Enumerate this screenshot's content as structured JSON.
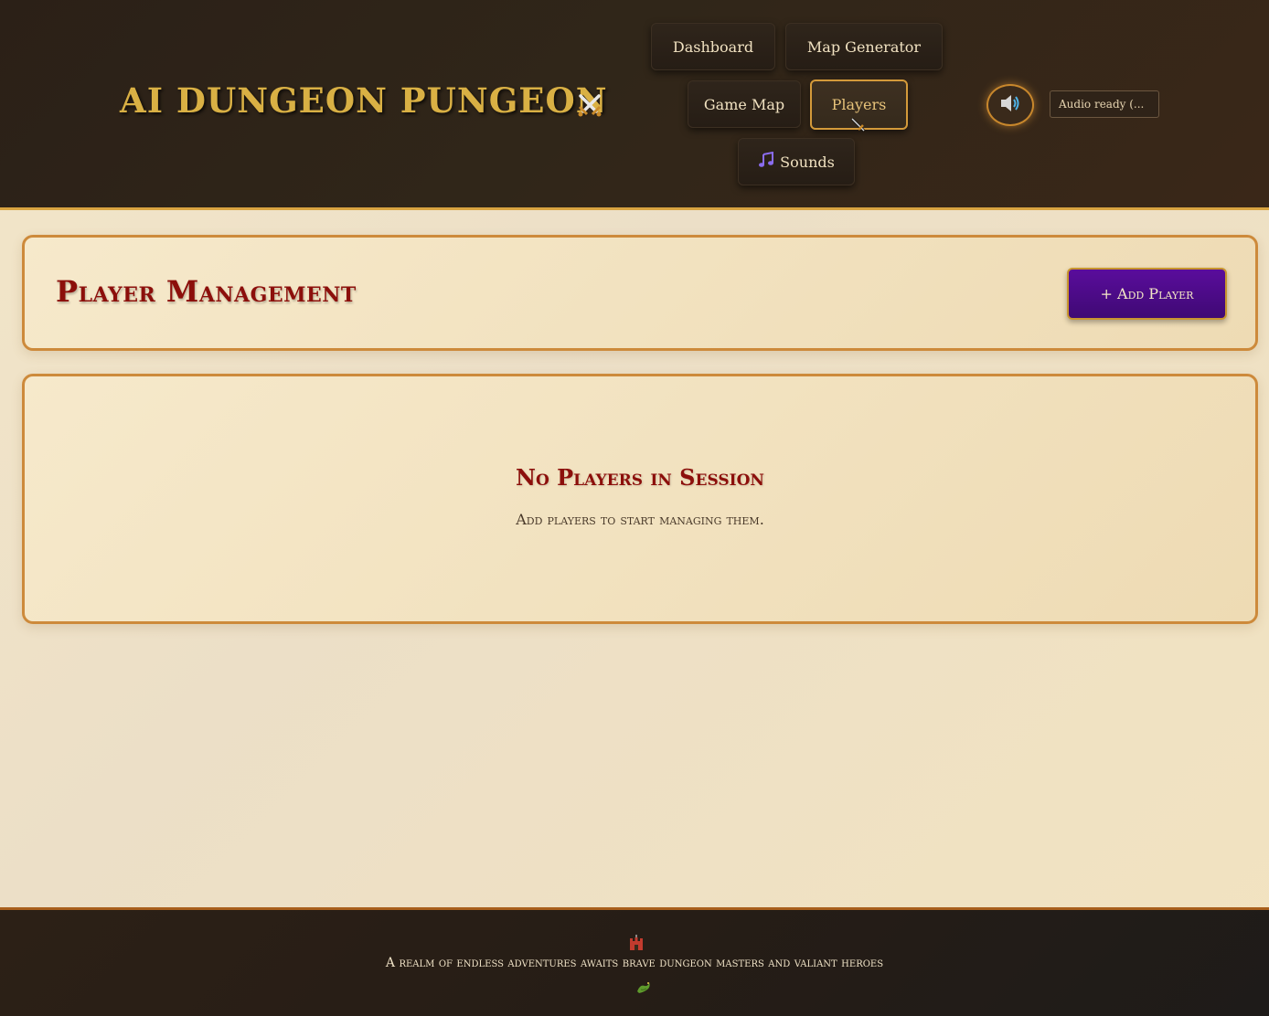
{
  "header": {
    "app_title": "AI DUNGEON PUNGEON",
    "title_icon": "crossed-swords-icon",
    "nav": [
      {
        "label": "Dashboard",
        "icon": ""
      },
      {
        "label": "Map Generator",
        "icon": ""
      },
      {
        "label": "Game Map",
        "icon": ""
      },
      {
        "label": "Players",
        "icon": "",
        "active": true
      },
      {
        "label": "Sounds",
        "icon": "music-note-icon"
      }
    ],
    "audio_button_icon": "speaker-icon",
    "audio_status": "Audio ready (..."
  },
  "main": {
    "panel_title": "Player Management",
    "add_player_label": "+ Add Player",
    "empty_title": "No Players in Session",
    "empty_subtitle": "Add players to start managing them."
  },
  "footer": {
    "top_icon": "castle-icon",
    "tagline": "A realm of endless adventures awaits brave dungeon masters and valiant heroes",
    "bottom_icon": "dragon-icon"
  },
  "colors": {
    "header_bg": "#2b2017",
    "accent_gold": "#d9b044",
    "title_red": "#8c0f0b",
    "add_button_purple": "#4f0b8b",
    "panel_border": "#cd8a3b"
  }
}
